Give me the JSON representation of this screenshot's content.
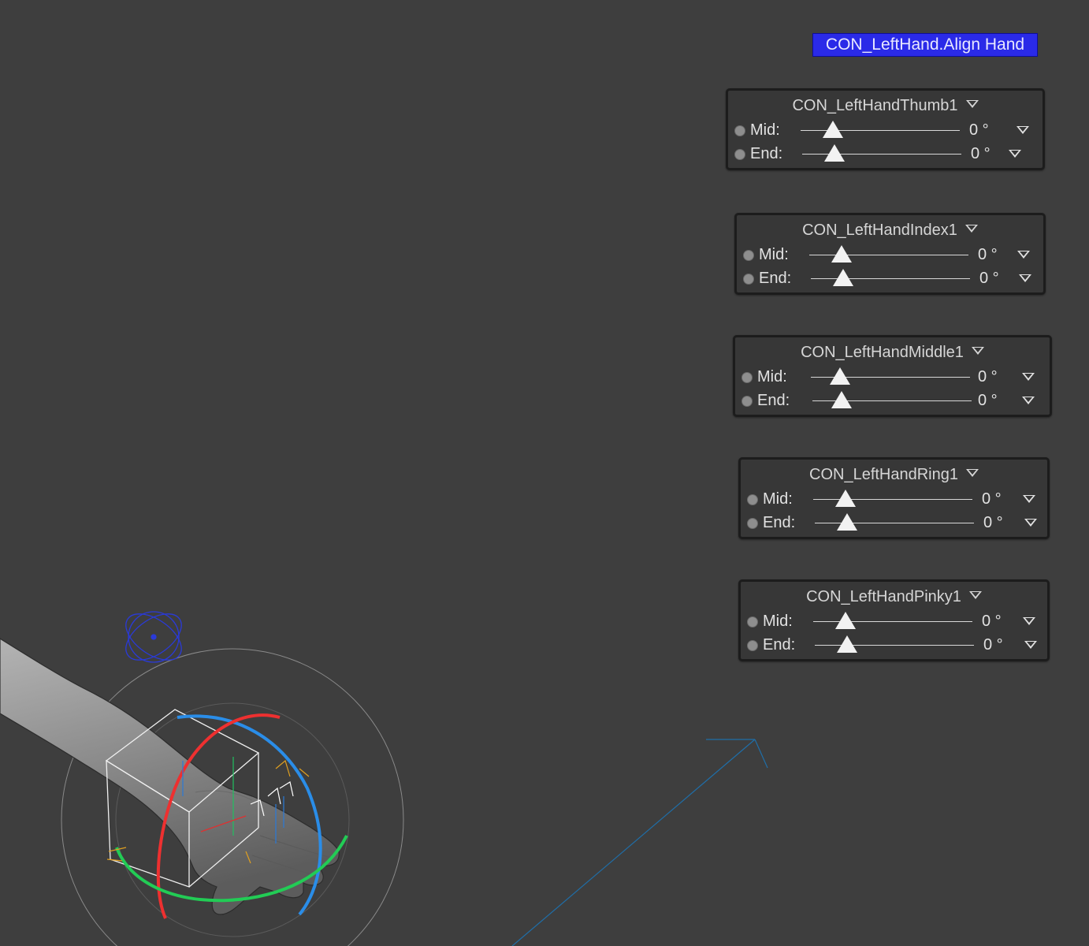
{
  "viewport": {
    "background_color": "#3e3e3e"
  },
  "align_label": "CON_LeftHand.Align Hand",
  "panels": [
    {
      "title": "CON_LeftHandThumb1",
      "mid": {
        "label": "Mid:",
        "value": "0 °",
        "level": 0.18
      },
      "end": {
        "label": "End:",
        "value": "0 °",
        "level": 0.18
      }
    },
    {
      "title": "CON_LeftHandIndex1",
      "mid": {
        "label": "Mid:",
        "value": "0 °",
        "level": 0.18
      },
      "end": {
        "label": "End:",
        "value": "0 °",
        "level": 0.18
      }
    },
    {
      "title": "CON_LeftHandMiddle1",
      "mid": {
        "label": "Mid:",
        "value": "0 °",
        "level": 0.18
      },
      "end": {
        "label": "End:",
        "value": "0 °",
        "level": 0.18
      }
    },
    {
      "title": "CON_LeftHandRing1",
      "mid": {
        "label": "Mid:",
        "value": "0 °",
        "level": 0.18
      },
      "end": {
        "label": "End:",
        "value": "0 °",
        "level": 0.18
      }
    },
    {
      "title": "CON_LeftHandPinky1",
      "mid": {
        "label": "Mid:",
        "value": "0 °",
        "level": 0.18
      },
      "end": {
        "label": "End:",
        "value": "0 °",
        "level": 0.18
      }
    }
  ],
  "colors": {
    "align_label_bg": "#2a2ae8",
    "gizmo_x": "#ff3030",
    "gizmo_y": "#20d060",
    "gizmo_z": "#2090ff",
    "locator": "#2a3ad8"
  }
}
